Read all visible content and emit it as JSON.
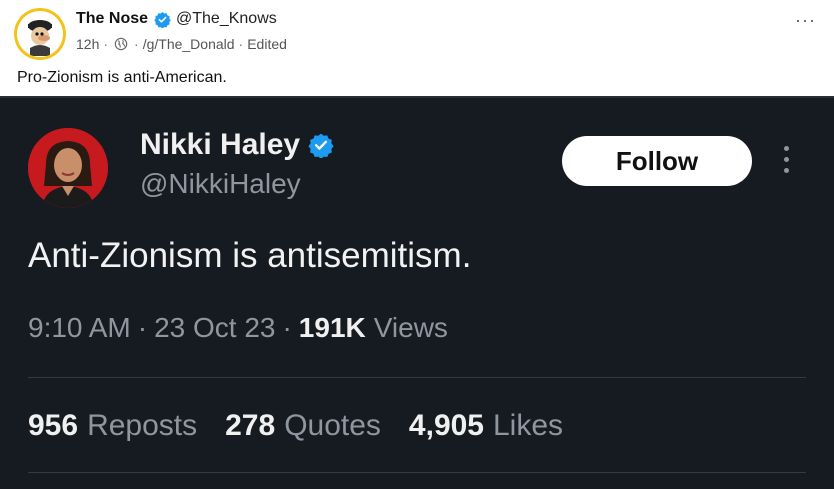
{
  "post": {
    "author_name": "The Nose",
    "author_handle": "@The_Knows",
    "time": "12h",
    "separator": "·",
    "community": "/g/The_Donald",
    "edited": "Edited",
    "more_label": "···",
    "body": "Pro-Zionism is anti-American."
  },
  "tweet": {
    "name": "Nikki Haley",
    "handle": "@NikkiHaley",
    "follow_label": "Follow",
    "text": "Anti-Zionism is antisemitism.",
    "time": "9:10 AM",
    "date": "23 Oct 23",
    "separator": "·",
    "views_count": "191K",
    "views_label": "Views",
    "stats": [
      {
        "value": "956",
        "label": "Reposts"
      },
      {
        "value": "278",
        "label": "Quotes"
      },
      {
        "value": "4,905",
        "label": "Likes"
      }
    ]
  },
  "colors": {
    "verified_blue": "#1d9bf0",
    "tweet_background": "#161b22",
    "avatar_ring": "#f4c21b",
    "tweet_avatar_bg": "#c61a1f"
  },
  "icons": {
    "post_avatar": "cartoon-avatar-icon",
    "verified": "verified-badge-icon",
    "globe": "globe-icon",
    "more": "more-options-icon"
  }
}
